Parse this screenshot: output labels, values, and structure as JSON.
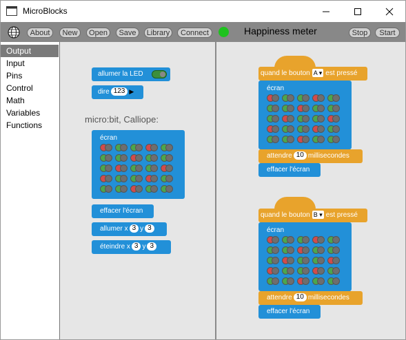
{
  "window": {
    "title": "MicroBlocks"
  },
  "toolbar": {
    "buttons": [
      "About",
      "New",
      "Open",
      "Save",
      "Library",
      "Connect"
    ],
    "project_title": "Happiness meter",
    "stop": "Stop",
    "start": "Start",
    "connected_color": "#1ec21e"
  },
  "categories": [
    {
      "label": "Output",
      "selected": true
    },
    {
      "label": "Input"
    },
    {
      "label": "Pins"
    },
    {
      "label": "Control"
    },
    {
      "label": "Math"
    },
    {
      "label": "Variables"
    },
    {
      "label": "Functions"
    }
  ],
  "palette": {
    "led_on": "allumer la LED",
    "say": "dire",
    "say_value": "123",
    "section": "micro:bit, Calliope:",
    "display": "écran",
    "clear": "effacer l'écran",
    "plot": "allumer x",
    "unplot": "éteindre x",
    "y": "y",
    "x_val": "3",
    "y_val": "3"
  },
  "scripts": [
    {
      "hat_prefix": "quand le bouton",
      "button": "A",
      "hat_suffix": "est pressé",
      "display": "écran",
      "wait": "attendre",
      "wait_value": "10",
      "wait_unit": "millisecondes",
      "clear": "effacer l'écran"
    },
    {
      "hat_prefix": "quand le bouton",
      "button": "B",
      "hat_suffix": "est pressé",
      "display": "écran",
      "wait": "attendre",
      "wait_value": "10",
      "wait_unit": "millisecondes",
      "clear": "effacer l'écran"
    }
  ],
  "colors": {
    "block_blue": "#2290d8",
    "block_orange": "#e8a32c",
    "led_on": "#4ca64c",
    "led_red": "#d24b4b",
    "led_off": "#6e6e6e"
  }
}
